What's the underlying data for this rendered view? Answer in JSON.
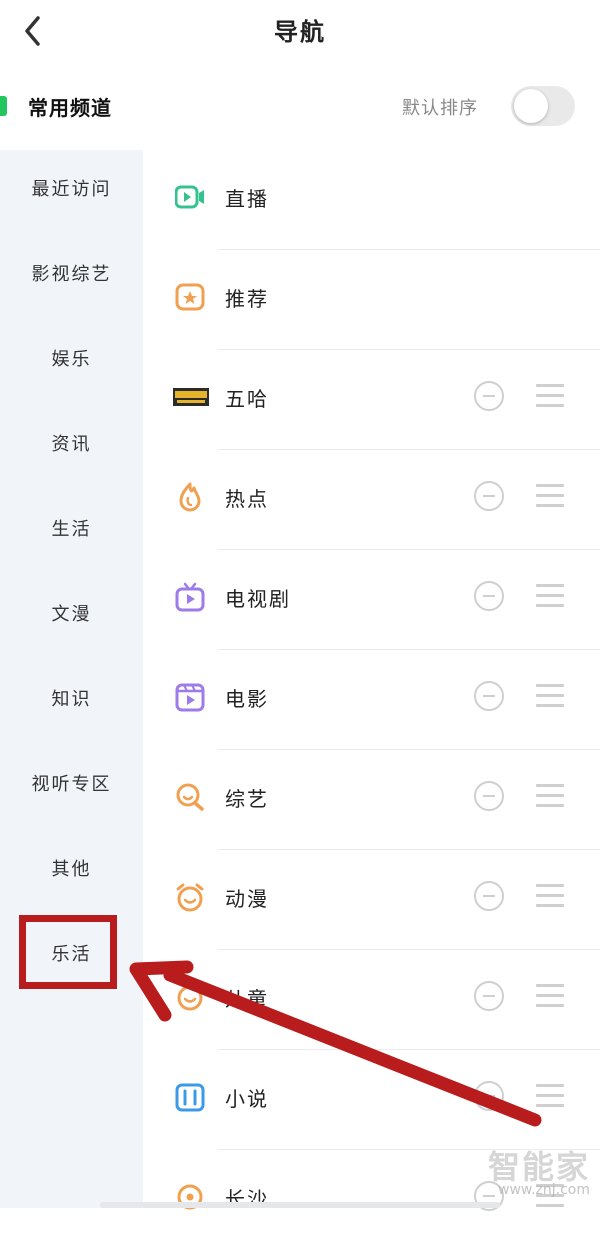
{
  "header": {
    "title": "导航"
  },
  "section": {
    "title": "常用频道",
    "sort_label": "默认排序",
    "sort_toggle_on": false
  },
  "sidebar": {
    "items": [
      "最近访问",
      "影视综艺",
      "娱乐",
      "资讯",
      "生活",
      "文漫",
      "知识",
      "视听专区",
      "其他",
      "乐活"
    ],
    "highlighted": "乐活"
  },
  "channels": [
    {
      "label": "直播",
      "icon": "live-video-icon",
      "removable": false
    },
    {
      "label": "推荐",
      "icon": "recommend-star-icon",
      "removable": false
    },
    {
      "label": "五哈",
      "icon": "wuha-badge-icon",
      "removable": true
    },
    {
      "label": "热点",
      "icon": "flame-icon",
      "removable": true
    },
    {
      "label": "电视剧",
      "icon": "tv-icon",
      "removable": true
    },
    {
      "label": "电影",
      "icon": "film-icon",
      "removable": true
    },
    {
      "label": "综艺",
      "icon": "variety-search-icon",
      "removable": true
    },
    {
      "label": "动漫",
      "icon": "anime-alarm-icon",
      "removable": true
    },
    {
      "label": "儿童",
      "icon": "kids-icon",
      "removable": true
    },
    {
      "label": "小说",
      "icon": "book-icon",
      "removable": true
    },
    {
      "label": "长沙",
      "icon": "location-pin-icon",
      "removable": true
    }
  ],
  "colors": {
    "accent_green": "#22c55e",
    "annotation_red": "#b91c1c",
    "sidebar_bg": "#f1f4f9"
  },
  "watermark": {
    "text": "智能家",
    "url": "www.znj.com"
  }
}
